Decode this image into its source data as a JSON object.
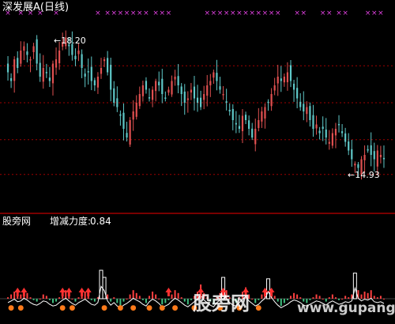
{
  "header": {
    "title": "深发展A(日线)"
  },
  "indicator": {
    "name": "股旁网",
    "label": "增减力度:",
    "value": "0.84"
  },
  "watermark": {
    "text": "股旁网",
    "domain": "www.gupang.com"
  },
  "colors": {
    "background": "#000000",
    "up": "#e05050",
    "down": "#5fc8c8",
    "grid": "#a00000",
    "separator": "#c00000",
    "marker": "#e040e0",
    "arrow": "#ff3030",
    "label_orange": "#ff7a1a",
    "osc_green": "#40c080",
    "osc_red": "#ff4040",
    "osc_line": "#ffffff"
  },
  "chart_data": {
    "type": "candlestick",
    "title": "深发展A(日线)",
    "ylim": [
      14.2,
      18.6
    ],
    "price_gridlines": [
      17.45,
      16.6,
      15.75,
      14.95
    ],
    "annotations": [
      {
        "text": "18.20",
        "value": 18.2
      },
      {
        "text": "14.93",
        "value": 14.93
      }
    ],
    "closes": [
      17.3,
      17.1,
      17.6,
      17.4,
      17.8,
      17.9,
      17.7,
      17.6,
      17.9,
      17.5,
      17.2,
      17.4,
      17.3,
      17.1,
      17.5,
      17.6,
      17.8,
      18.0,
      18.1,
      17.9,
      17.7,
      17.6,
      17.8,
      17.4,
      17.2,
      17.3,
      17.1,
      17.0,
      17.2,
      17.4,
      17.6,
      17.3,
      16.9,
      16.6,
      16.5,
      16.3,
      16.0,
      15.8,
      16.2,
      16.4,
      16.6,
      16.8,
      17.0,
      16.9,
      16.7,
      16.9,
      17.1,
      17.0,
      16.8,
      16.7,
      16.9,
      17.1,
      17.2,
      17.0,
      16.8,
      16.6,
      16.7,
      16.9,
      16.7,
      16.6,
      16.5,
      16.8,
      17.0,
      17.1,
      17.3,
      17.1,
      16.9,
      16.8,
      16.6,
      16.4,
      16.2,
      16.1,
      16.0,
      16.3,
      16.2,
      16.0,
      15.8,
      16.0,
      16.2,
      16.4,
      16.5,
      16.6,
      16.8,
      17.0,
      17.2,
      17.1,
      17.2,
      17.3,
      17.1,
      16.9,
      16.7,
      16.5,
      16.4,
      16.5,
      16.2,
      16.0,
      16.1,
      15.9,
      16.0,
      15.8,
      15.7,
      15.9,
      16.0,
      16.1,
      15.9,
      15.7,
      15.5,
      15.3,
      15.2,
      15.1,
      15.3,
      15.4,
      15.5,
      15.4,
      15.3,
      15.5,
      15.4,
      15.3
    ],
    "markers": [
      0,
      4,
      7,
      10,
      15,
      28,
      31,
      33,
      35,
      37,
      39,
      41,
      43,
      46,
      48,
      50,
      62,
      64,
      66,
      68,
      70,
      72,
      74,
      76,
      78,
      80,
      82,
      84,
      90,
      92,
      98,
      100,
      103,
      105,
      112,
      114,
      116
    ],
    "indicator": {
      "name": "增减力度",
      "value": 0.84,
      "values": [
        0.1,
        0.3,
        0.5,
        0.2,
        0.3,
        0.6,
        0.4,
        0.1,
        -0.1,
        -0.2,
        0.0,
        0.3,
        0.2,
        -0.1,
        -0.3,
        -0.2,
        0.1,
        0.4,
        0.6,
        0.3,
        0.0,
        -0.2,
        0.1,
        0.3,
        0.5,
        0.2,
        -0.1,
        -0.2,
        0.1,
        2.0,
        1.5,
        0.3,
        -0.2,
        0.1,
        -0.3,
        -0.5,
        -0.2,
        0.0,
        0.3,
        0.6,
        0.4,
        0.2,
        -0.1,
        -0.3,
        0.2,
        0.5,
        0.3,
        0.0,
        -0.4,
        -0.3,
        -0.1,
        0.3,
        0.6,
        0.4,
        0.1,
        -0.2,
        -0.4,
        -0.1,
        0.2,
        0.5,
        1.0,
        0.4,
        0.1,
        -0.2,
        -0.4,
        0.1,
        0.4,
        1.5,
        0.6,
        0.1,
        -0.2,
        -0.3,
        0.1,
        0.5,
        0.8,
        0.3,
        0.0,
        -0.3,
        -0.1,
        0.3,
        0.6,
        1.4,
        0.7,
        0.2,
        -0.2,
        -0.5,
        -0.3,
        -0.1,
        0.2,
        0.4,
        0.3,
        0.1,
        -0.2,
        -0.3,
        -0.1,
        0.1,
        0.3,
        0.2,
        0.0,
        -0.2,
        0.1,
        0.3,
        0.1,
        -0.1,
        0.0,
        0.2,
        0.1,
        0.3,
        1.8,
        0.6,
        0.3,
        0.5,
        0.4,
        0.6,
        0.2,
        0.1,
        0.2,
        0.0
      ],
      "up_arrows": [
        3,
        5,
        17,
        19,
        23,
        25,
        50,
        60,
        67,
        74,
        80,
        82
      ],
      "labels": [
        1,
        4,
        17,
        20,
        30,
        35,
        39,
        44,
        48,
        52,
        58,
        66,
        72,
        78
      ]
    }
  }
}
